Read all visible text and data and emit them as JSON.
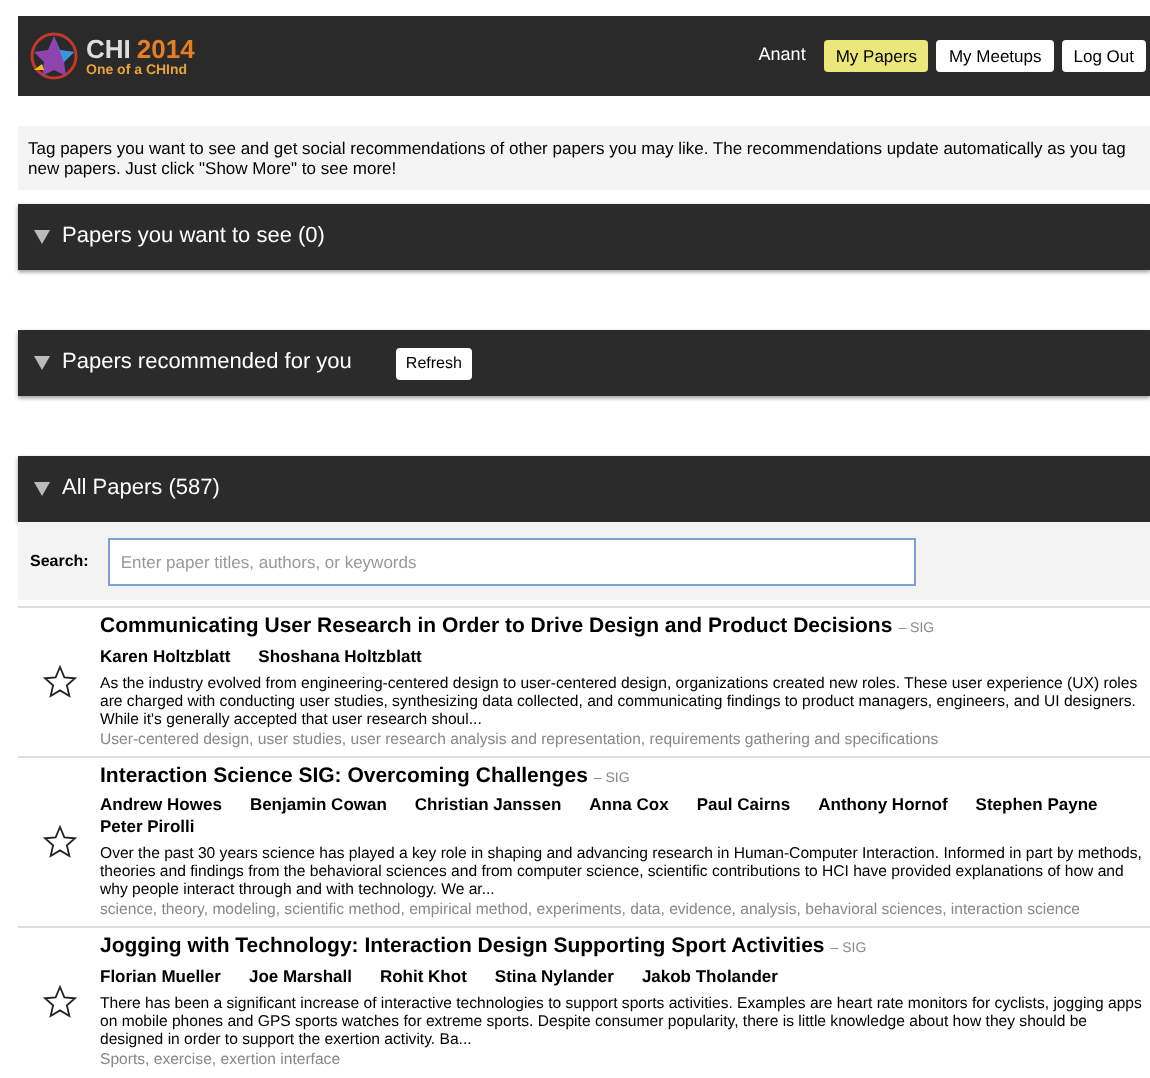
{
  "header": {
    "logo": {
      "title": "CHI",
      "year": "2014",
      "tagline": "One of a CHInd"
    },
    "user": "Anant",
    "nav": [
      {
        "label": "My Papers",
        "selected": true
      },
      {
        "label": "My Meetups",
        "selected": false
      },
      {
        "label": "Log Out",
        "selected": false
      }
    ]
  },
  "intro": "Tag papers you want to see and get social recommendations of other papers you may like. The recommendations update automatically as you tag new papers. Just click \"Show More\" to see more!",
  "sections": [
    {
      "title": "Papers you want to see (0)",
      "expanded": true
    },
    {
      "title": "Papers recommended for you",
      "expanded": true,
      "button": "Refresh"
    },
    {
      "title": "All Papers (587)",
      "expanded": true,
      "search": {
        "label": "Search:",
        "placeholder": "Enter paper titles, authors, or keywords"
      }
    }
  ],
  "papers": [
    {
      "title": "Communicating User Research in Order to Drive Design and Product Decisions",
      "type": "– SIG",
      "starred": false,
      "authors": [
        "Karen Holtzblatt",
        "Shoshana Holtzblatt"
      ],
      "abstract": "As the industry evolved from engineering-centered design to user-centered design, organizations created new roles. These user experience (UX) roles are charged with conducting user studies, synthesizing data collected, and communicating findings to product managers, engineers, and UI designers. While it's generally accepted that user research shoul...",
      "keywords": "User-centered design, user studies, user research analysis and representation, requirements gathering and specifications"
    },
    {
      "title": "Interaction Science SIG: Overcoming Challenges",
      "type": "– SIG",
      "starred": false,
      "authors": [
        "Andrew Howes",
        "Benjamin Cowan",
        "Christian Janssen",
        "Anna Cox",
        "Paul Cairns",
        "Anthony Hornof",
        "Stephen Payne",
        "Peter Pirolli"
      ],
      "abstract": "Over the past 30 years science has played a key role in shaping and advancing research in Human-Computer Interaction. Informed in part by methods, theories and findings from the behavioral sciences and from computer science, scientific contributions to HCI have provided explanations of how and why people interact through and with technology. We ar...",
      "keywords": "science, theory, modeling, scientific method, empirical method, experiments, data, evidence, analysis, behavioral sciences, interaction science"
    },
    {
      "title": "Jogging with Technology: Interaction Design Supporting Sport Activities",
      "type": "– SIG",
      "starred": false,
      "authors": [
        "Florian Mueller",
        "Joe Marshall",
        "Rohit Khot",
        "Stina Nylander",
        "Jakob Tholander"
      ],
      "abstract": "There has been a significant increase of interactive technologies to support sports activities. Examples are heart rate monitors for cyclists, jogging apps on mobile phones and GPS sports watches for extreme sports. Despite consumer popularity, there is little knowledge about how they should be designed in order to support the exertion activity. Ba...",
      "keywords": "Sports, exercise, exertion interface"
    }
  ]
}
